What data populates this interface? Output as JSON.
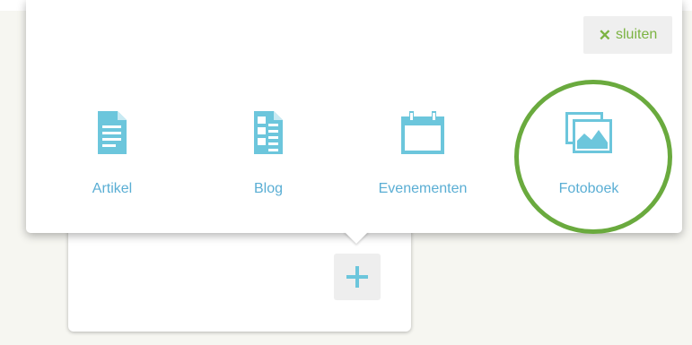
{
  "popup": {
    "close_label": "sluiten",
    "close_icon": "x-icon",
    "options": [
      {
        "label": "Artikel",
        "icon": "document-icon"
      },
      {
        "label": "Blog",
        "icon": "blog-list-icon"
      },
      {
        "label": "Evenementen",
        "icon": "calendar-icon"
      },
      {
        "label": "Fotoboek",
        "icon": "photo-album-icon"
      }
    ]
  },
  "card": {
    "add_label": "+"
  },
  "colors": {
    "accent_blue": "#6cc6dc",
    "label_blue": "#5aaed4",
    "close_green": "#7cb342",
    "highlight_green": "#6aaa3e"
  }
}
